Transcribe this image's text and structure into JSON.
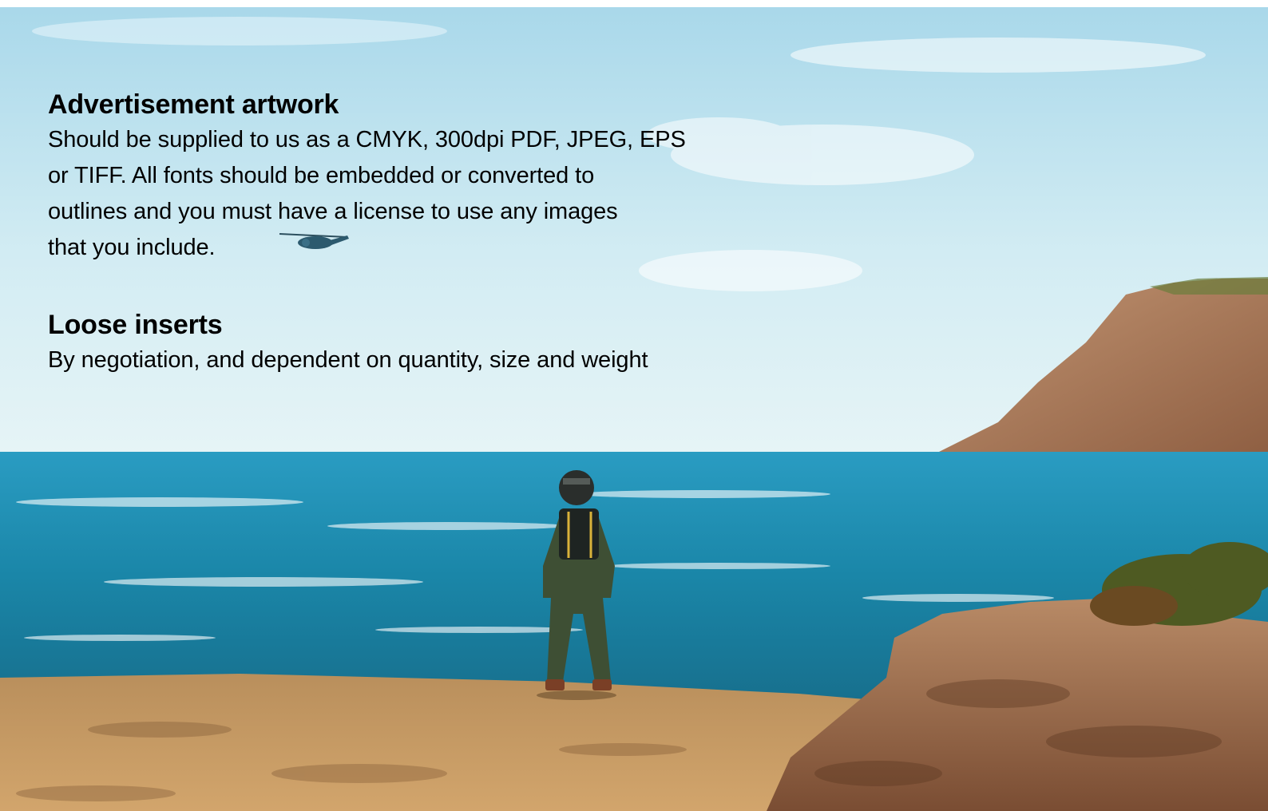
{
  "sections": [
    {
      "heading": "Advertisement artwork",
      "body": "Should be supplied to us as a CMYK, 300dpi PDF, JPEG, EPS\nor TIFF.  All fonts should be embedded or converted to\noutlines and you must have a license to use any images\nthat you include."
    },
    {
      "heading": "Loose inserts",
      "body": "By negotiation, and dependent on quantity, size and weight"
    }
  ],
  "background": {
    "sky_color": "#cfeaf2",
    "sea_color": "#1a86a8",
    "sand_color": "#c9a06a",
    "rock_color": "#9a6a4c"
  }
}
